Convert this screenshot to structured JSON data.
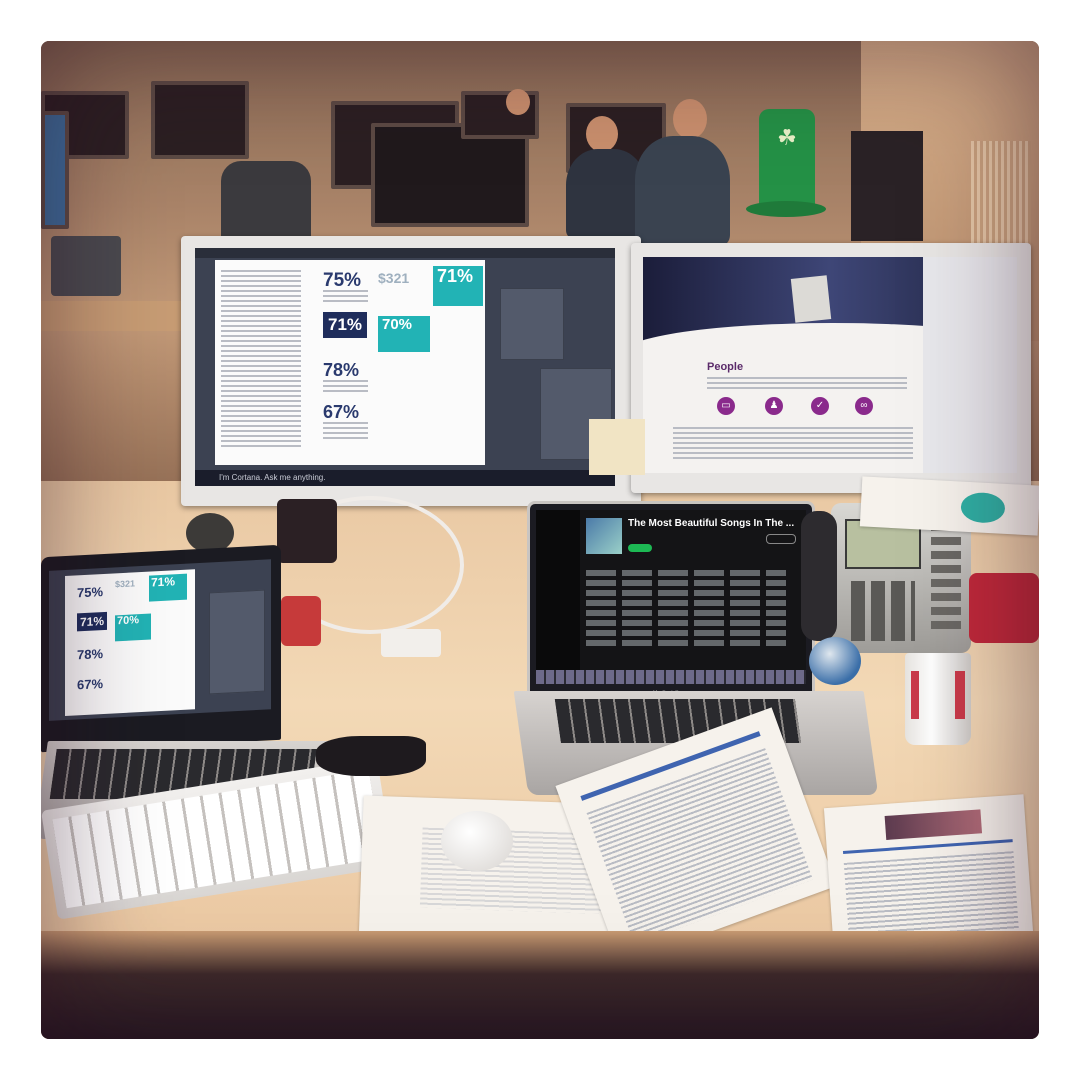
{
  "left_monitor": {
    "stats": [
      "75%",
      "71%",
      "78%",
      "67%"
    ],
    "panel_stats": [
      "71%",
      "70%"
    ],
    "money": "$321",
    "taskbar_search": "I'm Cortana. Ask me anything."
  },
  "right_monitor": {
    "section_heading": "People"
  },
  "left_laptop": {
    "stats": [
      "75%",
      "71%",
      "78%",
      "67%"
    ],
    "panel_stats": [
      "71%",
      "70%"
    ],
    "money": "$321"
  },
  "center_laptop": {
    "playlist_title": "The Most Beautiful Songs In The ...",
    "brand": "MacBook Pro"
  },
  "colors": {
    "teal": "#22b3b5",
    "navy": "#1f2d5c",
    "purple_icon": "#8a2a8c",
    "hat_green": "#249146"
  },
  "icons": [
    "shamrock-icon",
    "monitor-icon",
    "people-icon",
    "check-icon",
    "link-icon"
  ]
}
